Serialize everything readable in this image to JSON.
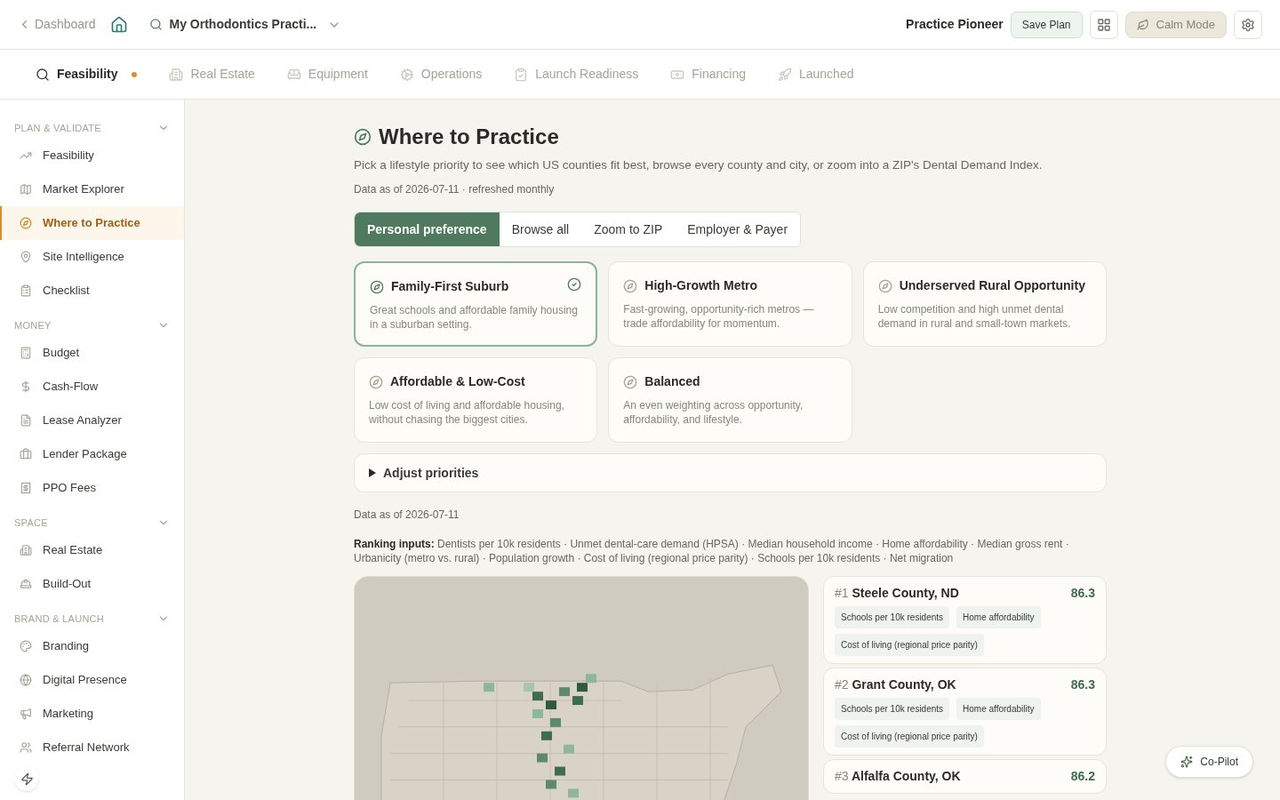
{
  "header": {
    "back_link": "Dashboard",
    "practice_selector": "My Orthodontics Practi...",
    "brand": "Practice Pioneer",
    "save_button": "Save Plan",
    "calm_mode": "Calm Mode"
  },
  "tabs": [
    {
      "label": "Feasibility",
      "selected": true,
      "dot": true
    },
    {
      "label": "Real Estate",
      "selected": false,
      "dot": false
    },
    {
      "label": "Equipment",
      "selected": false,
      "dot": false
    },
    {
      "label": "Operations",
      "selected": false,
      "dot": false
    },
    {
      "label": "Launch Readiness",
      "selected": false,
      "dot": false
    },
    {
      "label": "Financing",
      "selected": false,
      "dot": false
    },
    {
      "label": "Launched",
      "selected": false,
      "dot": false
    }
  ],
  "sidebar": {
    "sections": [
      {
        "title": "PLAN & VALIDATE",
        "expanded": true,
        "items": [
          {
            "label": "Feasibility",
            "selected": false
          },
          {
            "label": "Market Explorer",
            "selected": false
          },
          {
            "label": "Where to Practice",
            "selected": true
          },
          {
            "label": "Site Intelligence",
            "selected": false
          },
          {
            "label": "Checklist",
            "selected": false
          }
        ]
      },
      {
        "title": "MONEY",
        "expanded": true,
        "items": [
          {
            "label": "Budget",
            "selected": false
          },
          {
            "label": "Cash-Flow",
            "selected": false
          },
          {
            "label": "Lease Analyzer",
            "selected": false
          },
          {
            "label": "Lender Package",
            "selected": false
          },
          {
            "label": "PPO Fees",
            "selected": false
          }
        ]
      },
      {
        "title": "SPACE",
        "expanded": true,
        "items": [
          {
            "label": "Real Estate",
            "selected": false
          },
          {
            "label": "Build-Out",
            "selected": false
          }
        ]
      },
      {
        "title": "BRAND & LAUNCH",
        "expanded": true,
        "items": [
          {
            "label": "Branding",
            "selected": false
          },
          {
            "label": "Digital Presence",
            "selected": false
          },
          {
            "label": "Marketing",
            "selected": false
          },
          {
            "label": "Referral Network",
            "selected": false
          }
        ]
      }
    ]
  },
  "page": {
    "title": "Where to Practice",
    "subtitle": "Pick a lifestyle priority to see which US counties fit best, browse every county and city, or zoom into a ZIP's Dental Demand Index.",
    "data_as_of": "Data as of 2026-07-11 · refreshed monthly",
    "mode_tabs": [
      {
        "label": "Personal preference",
        "selected": true
      },
      {
        "label": "Browse all",
        "selected": false
      },
      {
        "label": "Zoom to ZIP",
        "selected": false
      },
      {
        "label": "Employer & Payer",
        "selected": false
      }
    ],
    "presets": [
      {
        "title": "Family-First Suburb",
        "description": "Great schools and affordable family housing in a suburban setting.",
        "selected": true
      },
      {
        "title": "High-Growth Metro",
        "description": "Fast-growing, opportunity-rich metros — trade affordability for momentum.",
        "selected": false
      },
      {
        "title": "Underserved Rural Opportunity",
        "description": "Low competition and high unmet dental demand in rural and small-town markets.",
        "selected": false
      },
      {
        "title": "Affordable & Low-Cost",
        "description": "Low cost of living and affordable housing, without chasing the biggest cities.",
        "selected": false
      },
      {
        "title": "Balanced",
        "description": "An even weighting across opportunity, affordability, and lifestyle.",
        "selected": false
      }
    ],
    "adjust_priorities": {
      "label": "Adjust priorities",
      "expanded": false
    },
    "data_note": "Data as of 2026-07-11",
    "ranking_inputs": "**Ranking inputs:** Dentists per 10k residents · Unmet dental-care demand (HPSA) · Median household income · Home affordability · Median gross rent · Urbanicity (metro vs. rural) · Population growth · Cost of living (regional price parity) · Schools per 10k residents · Net migration",
    "results": [
      {
        "rank": "#1",
        "name": "Steele County, ND",
        "score": "86.3",
        "tags": [
          "Schools per 10k residents",
          "Home affordability",
          "Cost of living (regional price parity)"
        ]
      },
      {
        "rank": "#2",
        "name": "Grant County, OK",
        "score": "86.3",
        "tags": [
          "Schools per 10k residents",
          "Home affordability",
          "Cost of living (regional price parity)"
        ]
      },
      {
        "rank": "#3",
        "name": "Alfalfa County, OK",
        "score": "86.2"
      }
    ]
  },
  "copilot": "Co-Pilot"
}
